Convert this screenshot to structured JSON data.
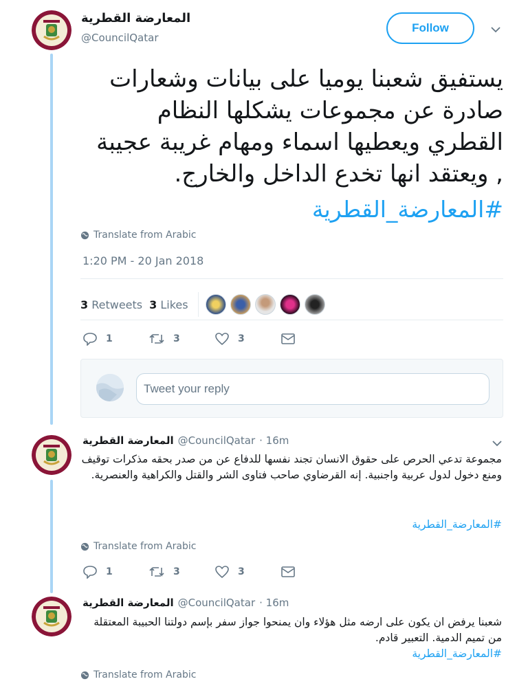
{
  "main_tweet": {
    "author_name": "المعارضة القطرية",
    "handle": "@CouncilQatar",
    "follow_label": "Follow",
    "text": "يستفيق شعبنا يوميا على بيانات وشعارات صادرة عن مجموعات يشكلها النظام القطري ويعطيها اسماء ومهام غريبة عجيبة , ويعتقد انها تخدع الداخل والخارج.",
    "hashtag": "#المعارضة_القطرية",
    "translate": "Translate from Arabic",
    "timestamp": "1:20 PM - 20 Jan 2018",
    "retweets_count": "3",
    "retweets_label": "Retweets",
    "likes_count": "3",
    "likes_label": "Likes",
    "replies": "1",
    "retweets": "3",
    "likes": "3"
  },
  "reply_box": {
    "placeholder": "Tweet your reply"
  },
  "replies": [
    {
      "author_name": "المعارضة القطرية",
      "handle": "@CouncilQatar",
      "time": "· 16m",
      "text": "مجموعة تدعي الحرص على حقوق الانسان تجند نفسها للدفاع عن من صدر بحقه مذكرات توقيف ومنع دخول لدول عربية واجنبية. إنه القرضاوي صاحب فتاوى الشر والقتل والكراهية والعنصرية.",
      "hashtag": "#المعارضة_القطرية",
      "translate": "Translate from Arabic",
      "replies": "1",
      "retweets": "3",
      "likes": "3"
    },
    {
      "author_name": "المعارضة القطرية",
      "handle": "@CouncilQatar",
      "time": "· 16m",
      "text": "شعبنا يرفض ان يكون على ارضه مثل هؤلاء وان يمنحوا جواز سفر بإسم دولتنا الحبيبة المعتقلة من تميم الدمية. التعبير قادم.",
      "hashtag": "#المعارضة_القطرية",
      "translate": "Translate from Arabic"
    }
  ],
  "icons": [
    "avatar-logo",
    "chevron-down-icon",
    "globe-icon",
    "reply-icon",
    "retweet-icon",
    "heart-icon",
    "message-icon"
  ],
  "colors": {
    "accent": "#1da1f2",
    "thread_line": "#a9d5f5",
    "muted": "#657786",
    "avatar_ring": "#8a1538"
  }
}
